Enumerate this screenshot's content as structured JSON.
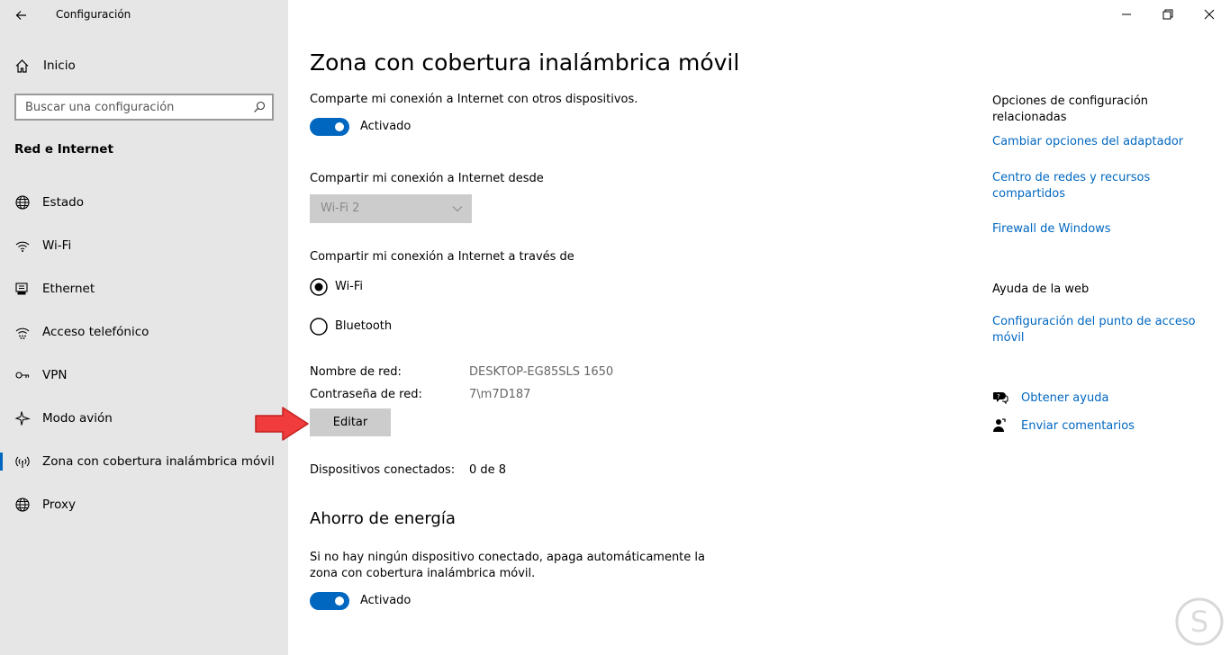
{
  "window": {
    "title": "Configuración",
    "minimize_icon": "minimize-icon",
    "restore_icon": "restore-icon",
    "close_icon": "close-icon"
  },
  "sidebar": {
    "home_label": "Inicio",
    "search_placeholder": "Buscar una configuración",
    "section_title": "Red e Internet",
    "items": [
      {
        "label": "Estado",
        "icon": "globe-status-icon"
      },
      {
        "label": "Wi-Fi",
        "icon": "wifi-icon"
      },
      {
        "label": "Ethernet",
        "icon": "ethernet-icon"
      },
      {
        "label": "Acceso telefónico",
        "icon": "dial-up-icon"
      },
      {
        "label": "VPN",
        "icon": "vpn-icon"
      },
      {
        "label": "Modo avión",
        "icon": "airplane-icon"
      },
      {
        "label": "Zona con cobertura inalámbrica móvil",
        "icon": "hotspot-icon",
        "selected": true
      },
      {
        "label": "Proxy",
        "icon": "globe-icon"
      }
    ]
  },
  "main": {
    "title": "Zona con cobertura inalámbrica móvil",
    "share_text": "Comparte mi conexión a Internet con otros dispositivos.",
    "share_toggle_label": "Activado",
    "share_from_label": "Compartir mi conexión a Internet desde",
    "share_from_value": "Wi-Fi 2",
    "share_over_label": "Compartir mi conexión a Internet a través de",
    "share_over_options": [
      "Wi-Fi",
      "Bluetooth"
    ],
    "share_over_selected": "Wi-Fi",
    "network_name_label": "Nombre de red:",
    "network_name_value": "DESKTOP-EG85SLS 1650",
    "network_password_label": "Contraseña de red:",
    "network_password_value": "7\\m7D187",
    "edit_button": "Editar",
    "connected_devices_label": "Dispositivos conectados:",
    "connected_devices_value": "0 de 8",
    "power_saving_title": "Ahorro de energía",
    "power_saving_text_line1": "Si no hay ningún dispositivo conectado, apaga automáticamente la",
    "power_saving_text_line2": "zona con cobertura inalámbrica móvil.",
    "power_saving_toggle_label": "Activado"
  },
  "related": {
    "title_line1": "Opciones de configuración",
    "title_line2": "relacionadas",
    "links": [
      {
        "line1": "Cambiar opciones del adaptador",
        "line2": ""
      },
      {
        "line1": "Centro de redes y recursos",
        "line2": "compartidos"
      },
      {
        "line1": "Firewall de Windows",
        "line2": ""
      }
    ],
    "web_help_title": "Ayuda de la web",
    "web_help_link_line1": "Configuración del punto de acceso",
    "web_help_link_line2": "móvil",
    "get_help": "Obtener ayuda",
    "send_feedback": "Enviar comentarios"
  },
  "colors": {
    "accent": "#0067c0",
    "sidebar_bg": "#e6e6e6",
    "annotation_arrow": "#f03c3c"
  }
}
